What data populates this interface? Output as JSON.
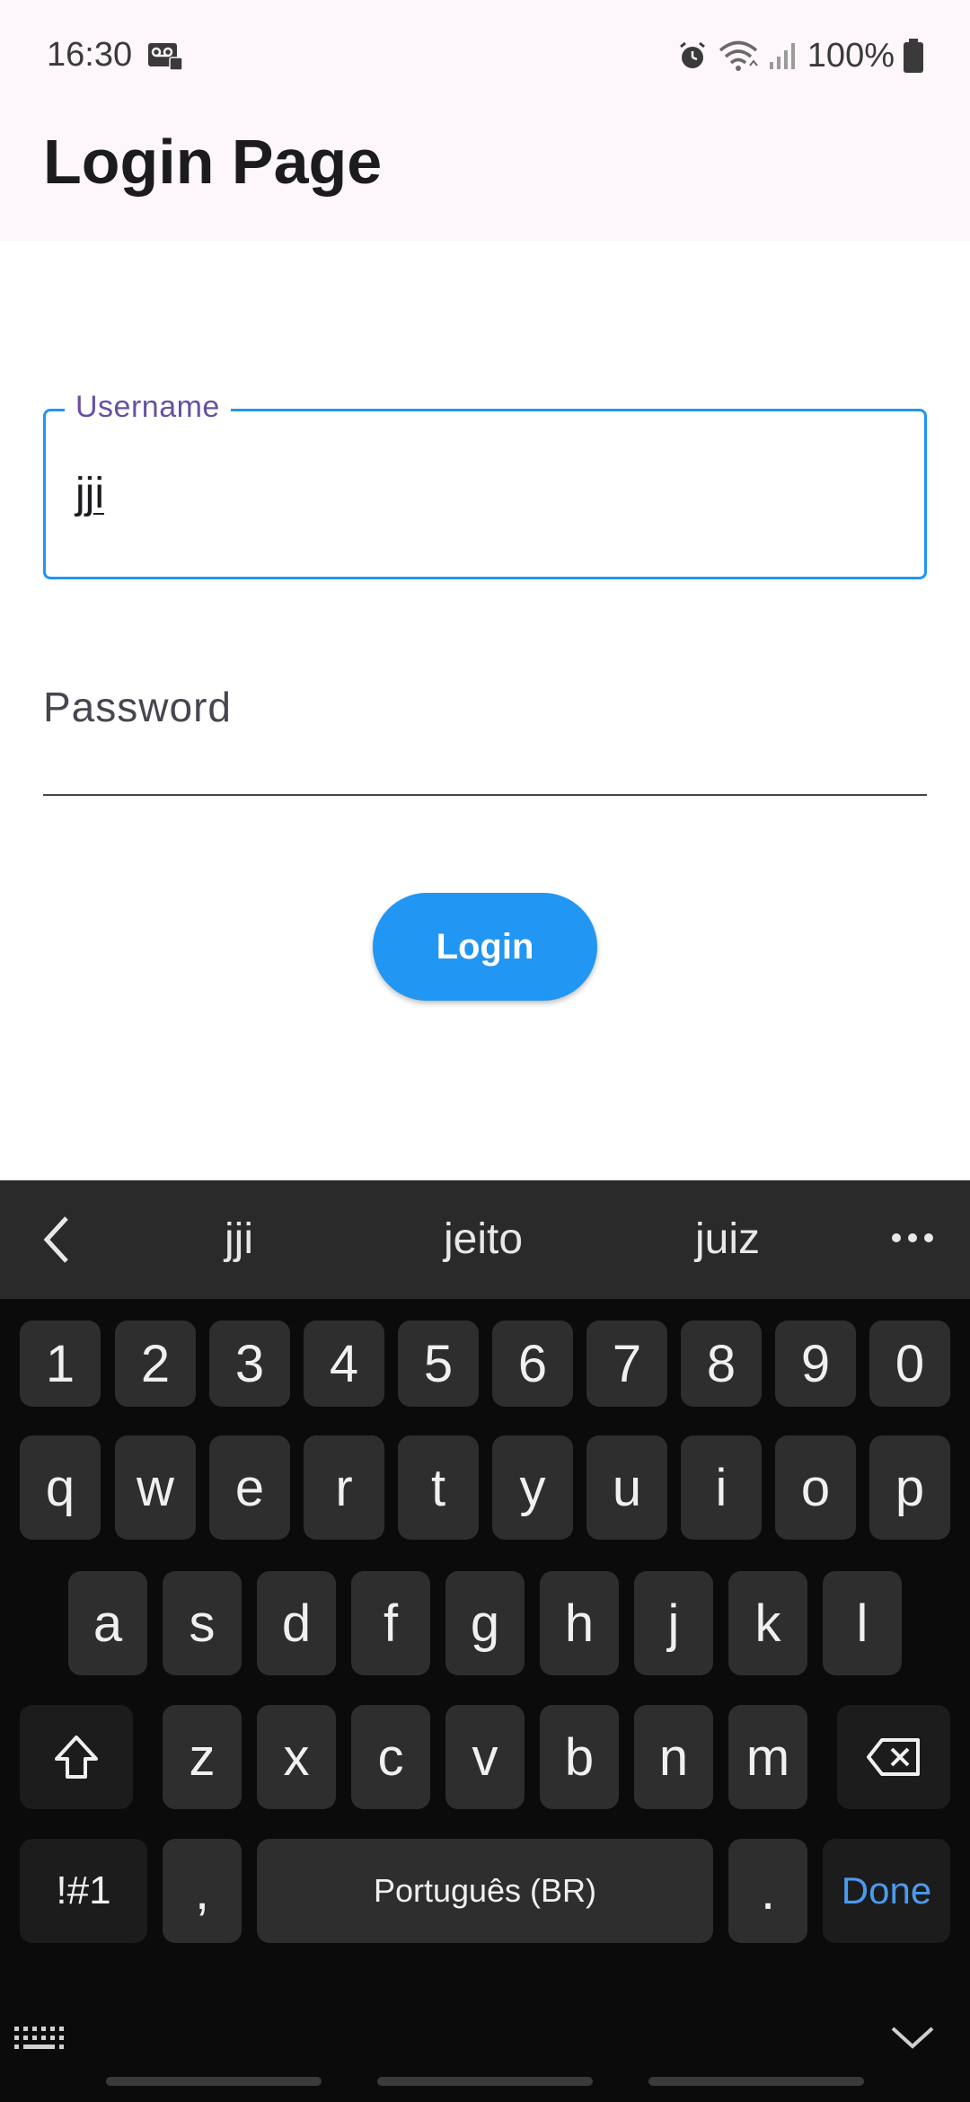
{
  "status_bar": {
    "time": "16:30",
    "battery": "100%",
    "icons": [
      "voicemail-icon",
      "alarm-icon",
      "wifi-icon",
      "signal-icon",
      "battery-icon"
    ]
  },
  "app_bar": {
    "title": "Login Page",
    "background": "#fdf7fb"
  },
  "form": {
    "username": {
      "label": "Username",
      "value": "jji"
    },
    "password": {
      "label": "Password",
      "value": ""
    },
    "login_button": "Login",
    "accent": "#2196f3",
    "label_color": "#6750a4"
  },
  "keyboard": {
    "suggestions": [
      "jji",
      "jeito",
      "juiz"
    ],
    "row_numbers": [
      "1",
      "2",
      "3",
      "4",
      "5",
      "6",
      "7",
      "8",
      "9",
      "0"
    ],
    "row_top": [
      "q",
      "w",
      "e",
      "r",
      "t",
      "y",
      "u",
      "i",
      "o",
      "p"
    ],
    "row_middle": [
      "a",
      "s",
      "d",
      "f",
      "g",
      "h",
      "j",
      "k",
      "l"
    ],
    "row_bottom": [
      "z",
      "x",
      "c",
      "v",
      "b",
      "n",
      "m"
    ],
    "symbols_key": "!#1",
    "comma_key": ",",
    "space_key": "Português (BR)",
    "period_key": ".",
    "done_key": "Done",
    "done_color": "#4a9bf0"
  }
}
